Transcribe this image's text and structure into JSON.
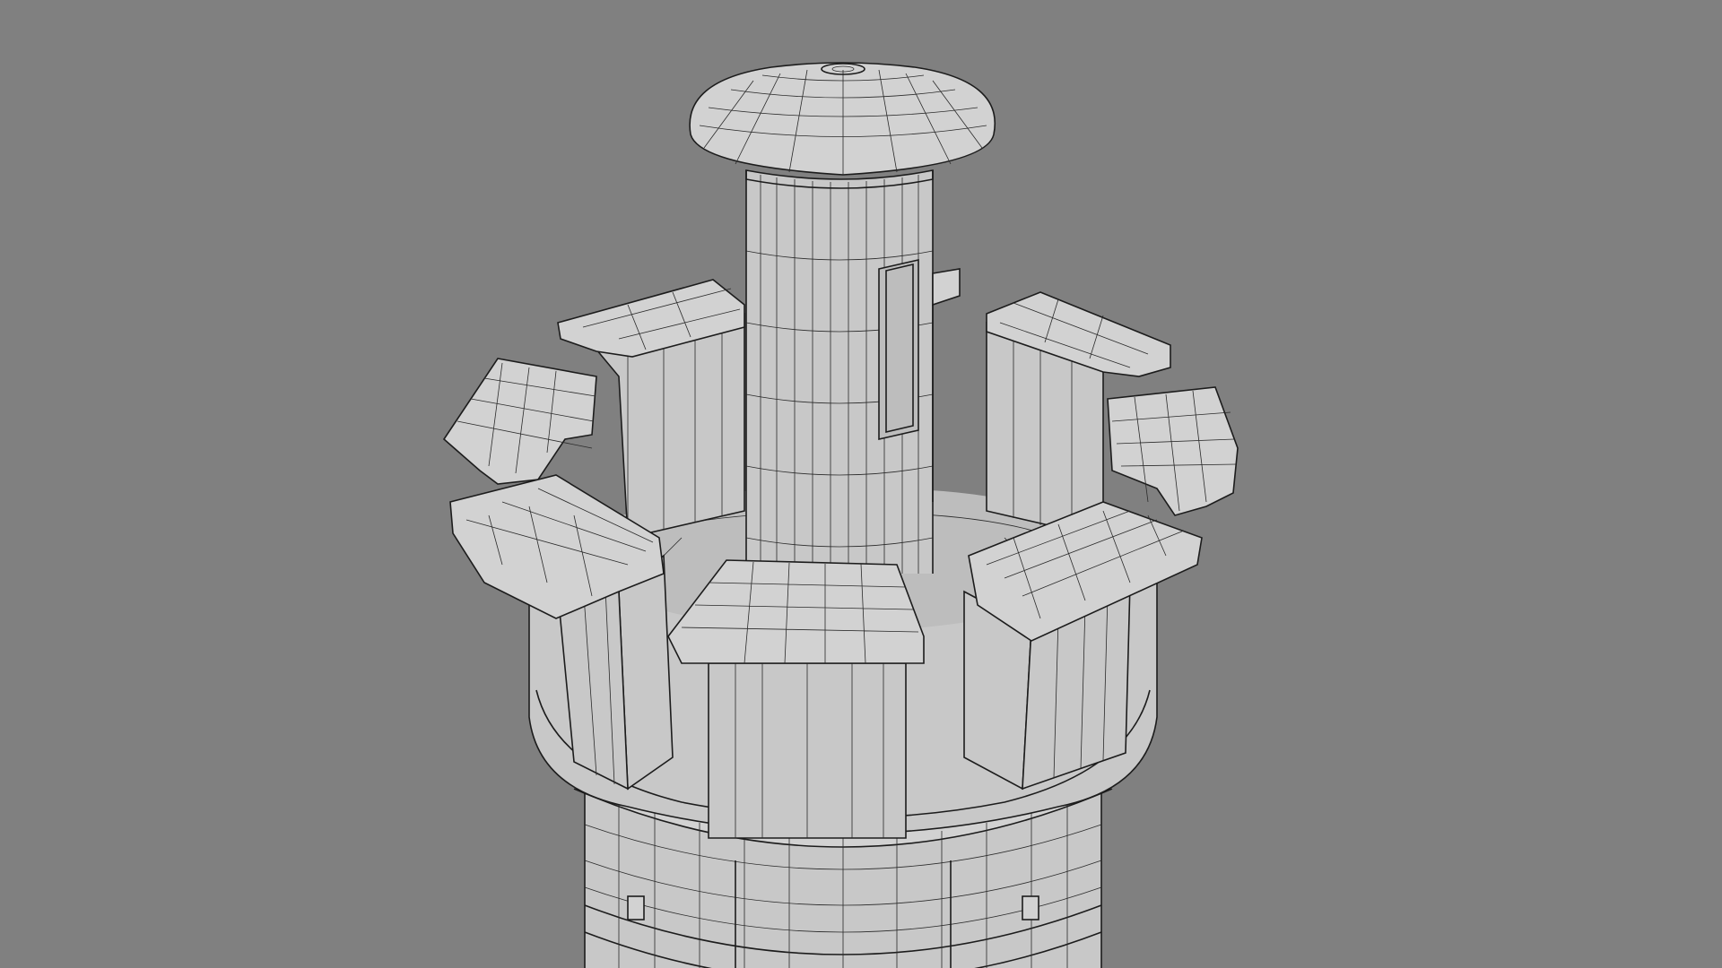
{
  "viewport": {
    "background": "#808080",
    "model_fill": "#c8c8c8",
    "wire_color": "#1c1c1c",
    "shading": "smooth-shaded-with-wireframe"
  }
}
